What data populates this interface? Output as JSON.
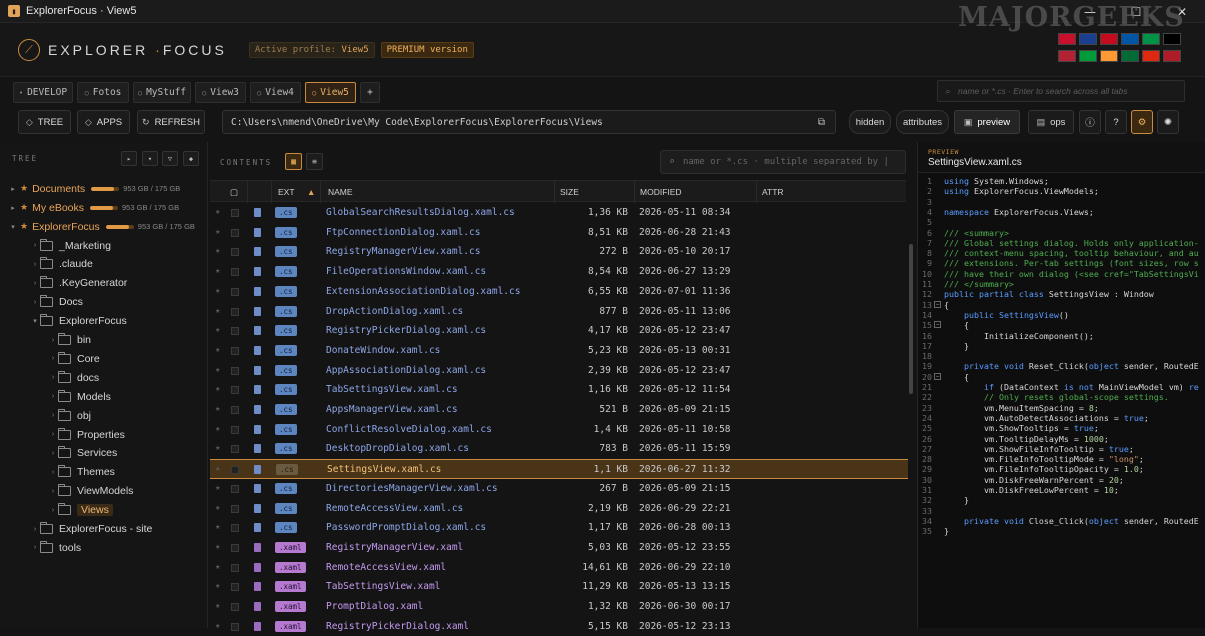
{
  "window": {
    "title": "ExplorerFocus · View5"
  },
  "header": {
    "logo_left": "EXPLORER",
    "logo_dot": "·",
    "logo_right": "FOCUS",
    "profile_label": "Active profile:",
    "profile_value": "View5",
    "premium": "PREMIUM version",
    "watermark": "MAJORGEEKS"
  },
  "flags": [
    "#c8102e",
    "#1a3f8e",
    "#c60b1e",
    "#0055a4",
    "#009246",
    "#000000",
    "#b22234",
    "#009c3b",
    "#ff9933",
    "#006c35",
    "#de2910",
    "#ae1c28"
  ],
  "tabs": [
    {
      "label": "DEVELOP",
      "active": false
    },
    {
      "label": "Fotos",
      "active": false
    },
    {
      "label": "MyStuff",
      "active": false
    },
    {
      "label": "View3",
      "active": false
    },
    {
      "label": "View4",
      "active": false
    },
    {
      "label": "View5",
      "active": true
    }
  ],
  "tabs_plus": "+",
  "global_search_placeholder": "name or *.cs · Enter to search across all tabs",
  "toolbar": {
    "tree": "TREE",
    "apps": "APPS",
    "refresh": "REFRESH",
    "path": "C:\\Users\\nmend\\OneDrive\\My Code\\ExplorerFocus\\ExplorerFocus\\Views",
    "hidden": "hidden",
    "attributes": "attributes",
    "preview": "preview",
    "ops": "ops",
    "help": "?"
  },
  "sidebar": {
    "header": "TREE",
    "favorites": [
      {
        "label": "Documents",
        "usage": "953 GB / 175 GB",
        "fill": 0.82
      },
      {
        "label": "My eBooks",
        "usage": "953 GB / 175 GB",
        "fill": 0.82
      },
      {
        "label": "ExplorerFocus",
        "usage": "953 GB / 175 GB",
        "fill": 0.82
      }
    ],
    "folders": [
      "_Marketing",
      ".claude",
      ".KeyGenerator",
      "Docs",
      "ExplorerFocus",
      "bin",
      "Core",
      "docs",
      "Models",
      "obj",
      "Properties",
      "Services",
      "Themes",
      "ViewModels",
      "Views",
      "ExplorerFocus - site",
      "tools"
    ]
  },
  "content": {
    "header": "CONTENTS",
    "filter_placeholder": "name  or  *.cs  ·  multiple separated by |",
    "columns": {
      "ext": "EXT",
      "name": "NAME",
      "size": "SIZE",
      "modified": "MODIFIED",
      "attr": "ATTR"
    },
    "rows": [
      {
        "ext": ".cs",
        "name": "GlobalSearchResultsDialog.xaml.cs",
        "size": "1,36 KB",
        "modified": "2026-05-11  08:34"
      },
      {
        "ext": ".cs",
        "name": "FtpConnectionDialog.xaml.cs",
        "size": "8,51 KB",
        "modified": "2026-06-28  21:43"
      },
      {
        "ext": ".cs",
        "name": "RegistryManagerView.xaml.cs",
        "size": "272 B",
        "modified": "2026-05-10  20:17"
      },
      {
        "ext": ".cs",
        "name": "FileOperationsWindow.xaml.cs",
        "size": "8,54 KB",
        "modified": "2026-06-27  13:29"
      },
      {
        "ext": ".cs",
        "name": "ExtensionAssociationDialog.xaml.cs",
        "size": "6,55 KB",
        "modified": "2026-07-01  11:36"
      },
      {
        "ext": ".cs",
        "name": "DropActionDialog.xaml.cs",
        "size": "877 B",
        "modified": "2026-05-11  13:06"
      },
      {
        "ext": ".cs",
        "name": "RegistryPickerDialog.xaml.cs",
        "size": "4,17 KB",
        "modified": "2026-05-12  23:47"
      },
      {
        "ext": ".cs",
        "name": "DonateWindow.xaml.cs",
        "size": "5,23 KB",
        "modified": "2026-05-13  00:31"
      },
      {
        "ext": ".cs",
        "name": "AppAssociationDialog.xaml.cs",
        "size": "2,39 KB",
        "modified": "2026-05-12  23:47"
      },
      {
        "ext": ".cs",
        "name": "TabSettingsView.xaml.cs",
        "size": "1,16 KB",
        "modified": "2026-05-12  11:54"
      },
      {
        "ext": ".cs",
        "name": "AppsManagerView.xaml.cs",
        "size": "521 B",
        "modified": "2026-05-09  21:15"
      },
      {
        "ext": ".cs",
        "name": "ConflictResolveDialog.xaml.cs",
        "size": "1,4 KB",
        "modified": "2026-05-11  10:58"
      },
      {
        "ext": ".cs",
        "name": "DesktopDropDialog.xaml.cs",
        "size": "783 B",
        "modified": "2026-05-11  15:59"
      },
      {
        "ext": ".cs",
        "name": "SettingsView.xaml.cs",
        "size": "1,1 KB",
        "modified": "2026-06-27  11:32",
        "selected": true
      },
      {
        "ext": ".cs",
        "name": "DirectoriesManagerView.xaml.cs",
        "size": "267 B",
        "modified": "2026-05-09  21:15"
      },
      {
        "ext": ".cs",
        "name": "RemoteAccessView.xaml.cs",
        "size": "2,19 KB",
        "modified": "2026-06-29  22:21"
      },
      {
        "ext": ".cs",
        "name": "PasswordPromptDialog.xaml.cs",
        "size": "1,17 KB",
        "modified": "2026-06-28  00:13"
      },
      {
        "ext": ".xaml",
        "name": "RegistryManagerView.xaml",
        "size": "5,03 KB",
        "modified": "2026-05-12  23:55"
      },
      {
        "ext": ".xaml",
        "name": "RemoteAccessView.xaml",
        "size": "14,61 KB",
        "modified": "2026-06-29  22:10"
      },
      {
        "ext": ".xaml",
        "name": "TabSettingsView.xaml",
        "size": "11,29 KB",
        "modified": "2026-05-13  13:15"
      },
      {
        "ext": ".xaml",
        "name": "PromptDialog.xaml",
        "size": "1,32 KB",
        "modified": "2026-06-30  00:17"
      },
      {
        "ext": ".xaml",
        "name": "RegistryPickerDialog.xaml",
        "size": "5,15 KB",
        "modified": "2026-05-12  23:13"
      }
    ]
  },
  "preview": {
    "header": "PREVIEW",
    "filename": "SettingsView.xaml.cs",
    "lines": [
      {
        "n": "1",
        "parts": [
          [
            "k",
            "using"
          ],
          [
            "t",
            " System.Windows;"
          ]
        ]
      },
      {
        "n": "2",
        "parts": [
          [
            "k",
            "using"
          ],
          [
            "t",
            " ExplorerFocus.ViewModels;"
          ]
        ]
      },
      {
        "n": "3",
        "parts": []
      },
      {
        "n": "4",
        "parts": [
          [
            "k",
            "namespace"
          ],
          [
            "t",
            " ExplorerFocus.Views;"
          ]
        ]
      },
      {
        "n": "5",
        "parts": []
      },
      {
        "n": "6",
        "parts": [
          [
            "c",
            "/// <summary>"
          ]
        ]
      },
      {
        "n": "7",
        "parts": [
          [
            "c",
            "/// Global settings dialog. Holds only application-"
          ]
        ]
      },
      {
        "n": "8",
        "parts": [
          [
            "c",
            "/// context-menu spacing, tooltip behaviour, and au"
          ]
        ]
      },
      {
        "n": "9",
        "parts": [
          [
            "c",
            "/// extensions. Per-tab settings (font sizes, row s"
          ]
        ]
      },
      {
        "n": "10",
        "parts": [
          [
            "c",
            "/// have their own dialog (<see cref=\"TabSettingsVi"
          ]
        ]
      },
      {
        "n": "11",
        "parts": [
          [
            "c",
            "/// </summary>"
          ]
        ]
      },
      {
        "n": "12",
        "parts": [
          [
            "k",
            "public partial class"
          ],
          [
            "t",
            " SettingsView : Window"
          ]
        ]
      },
      {
        "n": "13",
        "fold": true,
        "parts": [
          [
            "t",
            "{"
          ]
        ]
      },
      {
        "n": "14",
        "parts": [
          [
            "t",
            "    "
          ],
          [
            "k",
            "public"
          ],
          [
            "k",
            " SettingsView"
          ],
          [
            "t",
            "()"
          ]
        ]
      },
      {
        "n": "15",
        "fold": true,
        "parts": [
          [
            "t",
            "    {"
          ]
        ]
      },
      {
        "n": "16",
        "parts": [
          [
            "t",
            "        InitializeComponent();"
          ]
        ]
      },
      {
        "n": "17",
        "parts": [
          [
            "t",
            "    }"
          ]
        ]
      },
      {
        "n": "18",
        "parts": []
      },
      {
        "n": "19",
        "parts": [
          [
            "t",
            "    "
          ],
          [
            "k",
            "private void"
          ],
          [
            "t",
            " Reset_Click("
          ],
          [
            "k",
            "object"
          ],
          [
            "t",
            " sender, RoutedE"
          ]
        ]
      },
      {
        "n": "20",
        "fold": true,
        "parts": [
          [
            "t",
            "    {"
          ]
        ]
      },
      {
        "n": "21",
        "parts": [
          [
            "t",
            "        "
          ],
          [
            "k",
            "if"
          ],
          [
            "t",
            " (DataContext "
          ],
          [
            "k",
            "is not"
          ],
          [
            "t",
            " MainViewModel vm) "
          ],
          [
            "k",
            "re"
          ]
        ]
      },
      {
        "n": "22",
        "parts": [
          [
            "t",
            "        "
          ],
          [
            "c",
            "// Only resets global-scope settings."
          ]
        ]
      },
      {
        "n": "23",
        "parts": [
          [
            "t",
            "        vm.MenuItemSpacing = "
          ],
          [
            "n",
            "8"
          ],
          [
            "t",
            ";"
          ]
        ]
      },
      {
        "n": "24",
        "parts": [
          [
            "t",
            "        vm.AutoDetectAssociations = "
          ],
          [
            "k",
            "true"
          ],
          [
            "t",
            ";"
          ]
        ]
      },
      {
        "n": "25",
        "parts": [
          [
            "t",
            "        vm.ShowTooltips = "
          ],
          [
            "k",
            "true"
          ],
          [
            "t",
            ";"
          ]
        ]
      },
      {
        "n": "26",
        "parts": [
          [
            "t",
            "        vm.TooltipDelayMs = "
          ],
          [
            "n",
            "1000"
          ],
          [
            "t",
            ";"
          ]
        ]
      },
      {
        "n": "27",
        "parts": [
          [
            "t",
            "        vm.ShowFileInfoTooltip = "
          ],
          [
            "k",
            "true"
          ],
          [
            "t",
            ";"
          ]
        ]
      },
      {
        "n": "28",
        "parts": [
          [
            "t",
            "        vm.FileInfoTooltipMode = "
          ],
          [
            "s",
            "\"long\""
          ],
          [
            "t",
            ";"
          ]
        ]
      },
      {
        "n": "29",
        "parts": [
          [
            "t",
            "        vm.FileInfoTooltipOpacity = "
          ],
          [
            "n",
            "1.0"
          ],
          [
            "t",
            ";"
          ]
        ]
      },
      {
        "n": "30",
        "parts": [
          [
            "t",
            "        vm.DiskFreeWarnPercent = "
          ],
          [
            "n",
            "20"
          ],
          [
            "t",
            ";"
          ]
        ]
      },
      {
        "n": "31",
        "parts": [
          [
            "t",
            "        vm.DiskFreeLowPercent = "
          ],
          [
            "n",
            "10"
          ],
          [
            "t",
            ";"
          ]
        ]
      },
      {
        "n": "32",
        "parts": [
          [
            "t",
            "    }"
          ]
        ]
      },
      {
        "n": "33",
        "parts": []
      },
      {
        "n": "34",
        "parts": [
          [
            "t",
            "    "
          ],
          [
            "k",
            "private void"
          ],
          [
            "t",
            " Close_Click("
          ],
          [
            "k",
            "object"
          ],
          [
            "t",
            " sender, RoutedE"
          ]
        ]
      },
      {
        "n": "35",
        "parts": [
          [
            "t",
            "}"
          ]
        ]
      }
    ]
  }
}
